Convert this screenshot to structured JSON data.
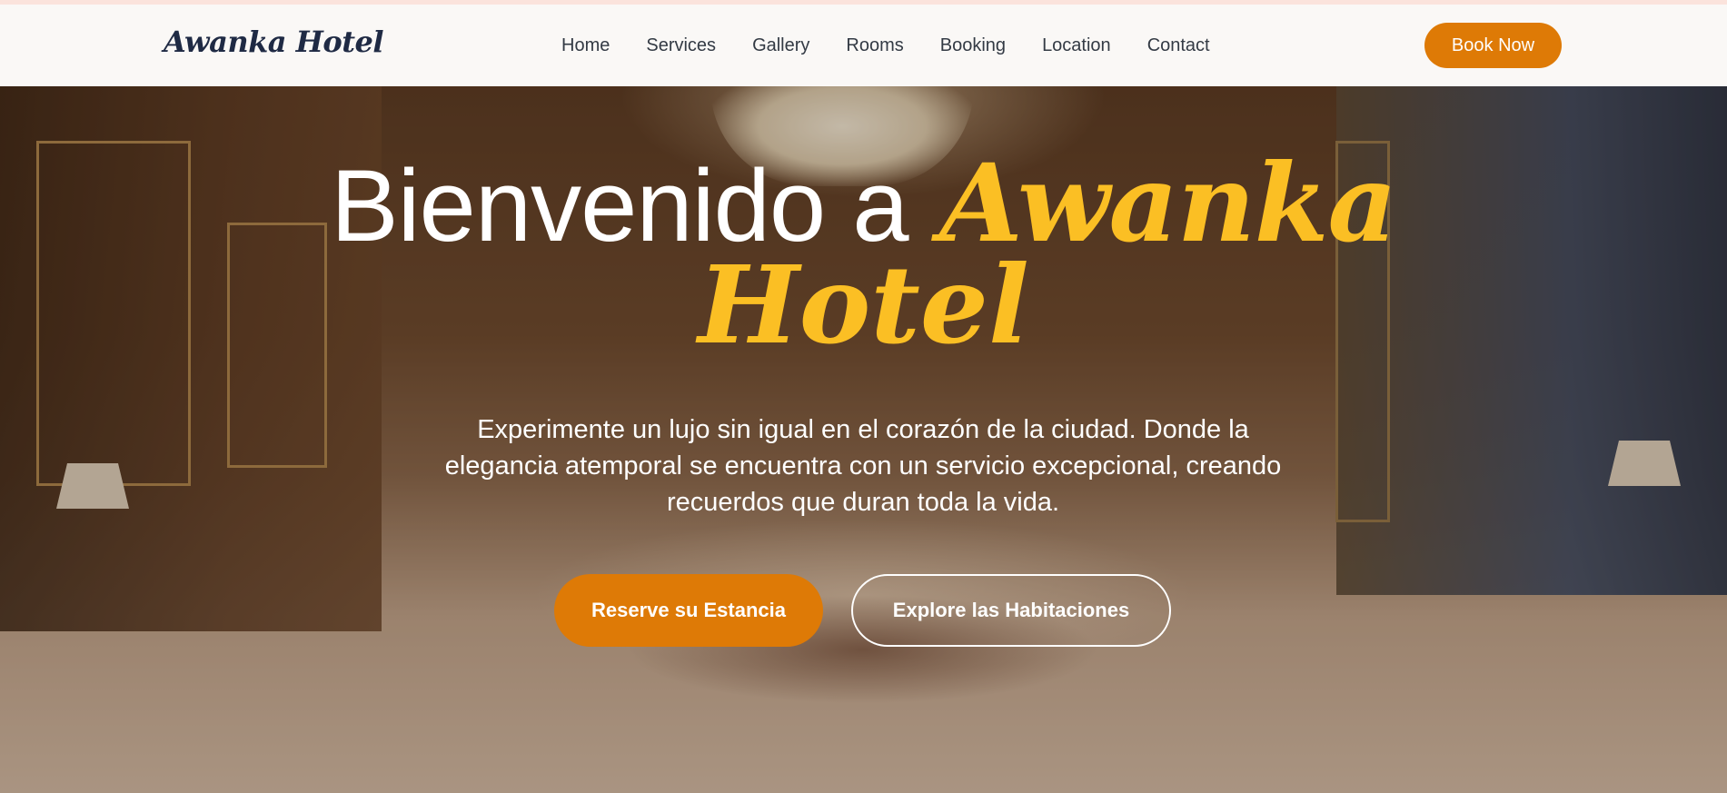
{
  "header": {
    "logo": "Awanka Hotel",
    "nav": [
      {
        "label": "Home"
      },
      {
        "label": "Services"
      },
      {
        "label": "Gallery"
      },
      {
        "label": "Rooms"
      },
      {
        "label": "Booking"
      },
      {
        "label": "Location"
      },
      {
        "label": "Contact"
      }
    ],
    "cta_label": "Book Now"
  },
  "hero": {
    "title_prefix": "Bienvenido a",
    "title_accent_1": "Awanka",
    "title_accent_2": "Hotel",
    "subtitle": "Experimente un lujo sin igual en el corazón de la ciudad. Donde la elegancia atemporal se encuentra con un servicio excepcional, creando recuerdos que duran toda la vida.",
    "primary_button": "Reserve su Estancia",
    "secondary_button": "Explore las Habitaciones"
  },
  "colors": {
    "accent": "#de7a06",
    "title_gold": "#fbbf24",
    "logo": "#1f2a44",
    "nav_text": "#333a44",
    "navbar_bg": "#faf8f6"
  }
}
